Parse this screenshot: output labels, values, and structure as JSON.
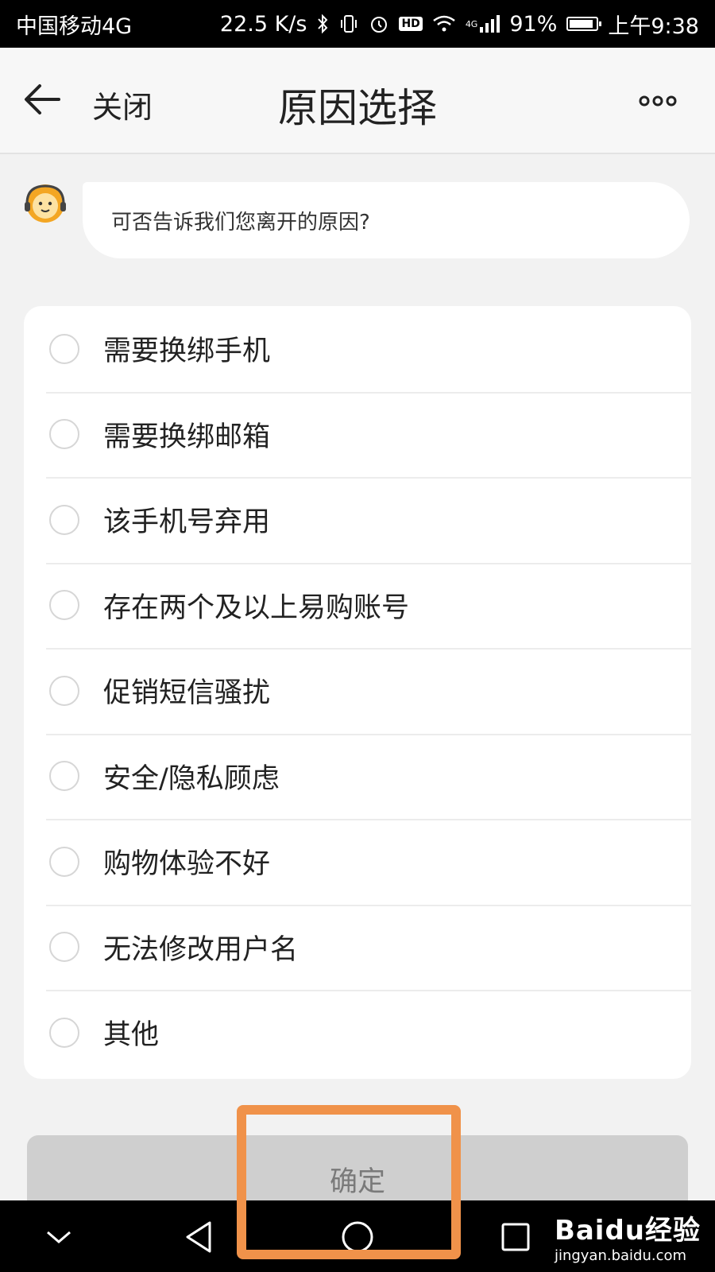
{
  "status_bar": {
    "carrier": "中国移动4G",
    "speed": "22.5 K/s",
    "hd": "HD",
    "network": "4G",
    "battery": "91%",
    "battery_level": 0.91,
    "time": "上午9:38"
  },
  "nav": {
    "close_label": "关闭",
    "title": "原因选择"
  },
  "assistant": {
    "question": "可否告诉我们您离开的原因?"
  },
  "options": [
    {
      "label": "需要换绑手机"
    },
    {
      "label": "需要换绑邮箱"
    },
    {
      "label": "该手机号弃用"
    },
    {
      "label": "存在两个及以上易购账号"
    },
    {
      "label": "促销短信骚扰"
    },
    {
      "label": "安全/隐私顾虑"
    },
    {
      "label": "购物体验不好"
    },
    {
      "label": "无法修改用户名"
    },
    {
      "label": "其他"
    }
  ],
  "confirm_label": "确定",
  "watermark": {
    "brand": "Baidu经验",
    "url": "jingyan.baidu.com"
  },
  "colors": {
    "highlight": "#f0924a",
    "button_disabled": "#cfcfcf"
  }
}
